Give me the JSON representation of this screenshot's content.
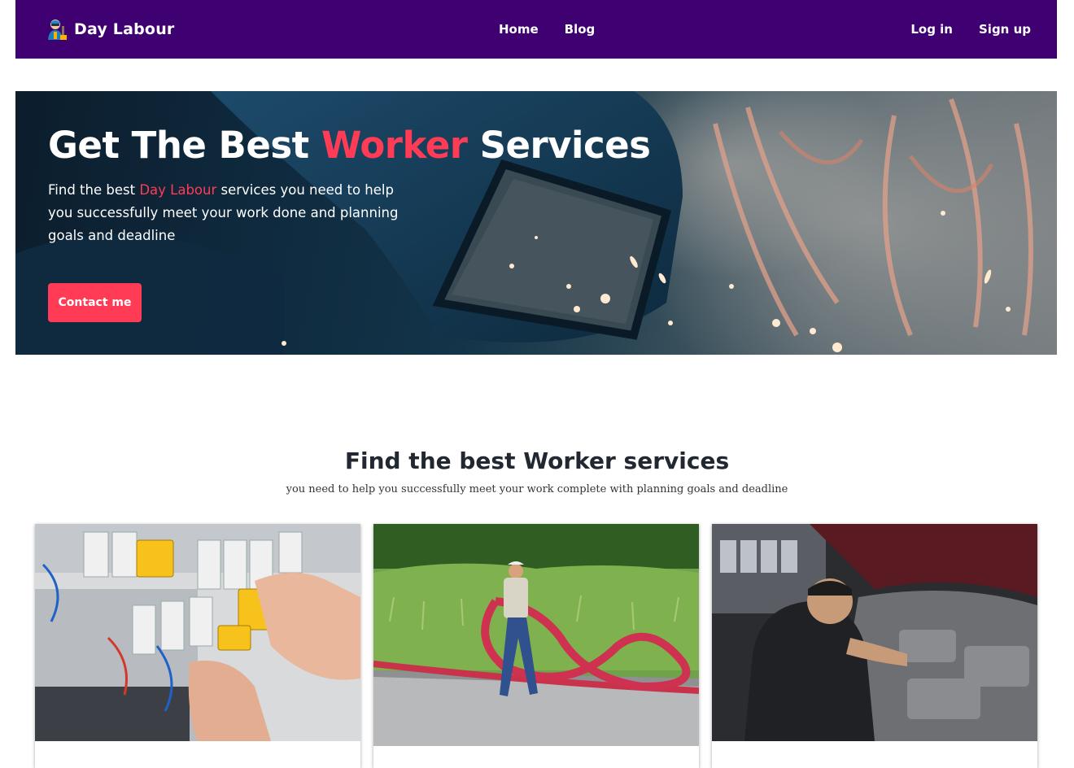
{
  "navbar": {
    "brand": "Day Labour",
    "links": [
      "Home",
      "Blog"
    ],
    "login": "Log in",
    "signup": "Sign up"
  },
  "hero": {
    "title_before": "Get The Best ",
    "title_accent": "Worker",
    "title_after": " Services",
    "desc_before": "Find the best ",
    "desc_accent": "Day Labour",
    "desc_after": " services you need to help you successfully meet your work done and planning goals and deadline",
    "button": "Contact me"
  },
  "services": {
    "title": "Find the best Worker services",
    "subtitle": "you need to help you successfully meet your work complete with planning goals and deadline",
    "cards": [
      {
        "image": "electrician-photo"
      },
      {
        "image": "hose-worker-photo"
      },
      {
        "image": "car-mechanic-photo"
      }
    ]
  },
  "colors": {
    "nav_bg": "#3f0071",
    "accent": "#ff3b56",
    "heading": "#222831"
  }
}
